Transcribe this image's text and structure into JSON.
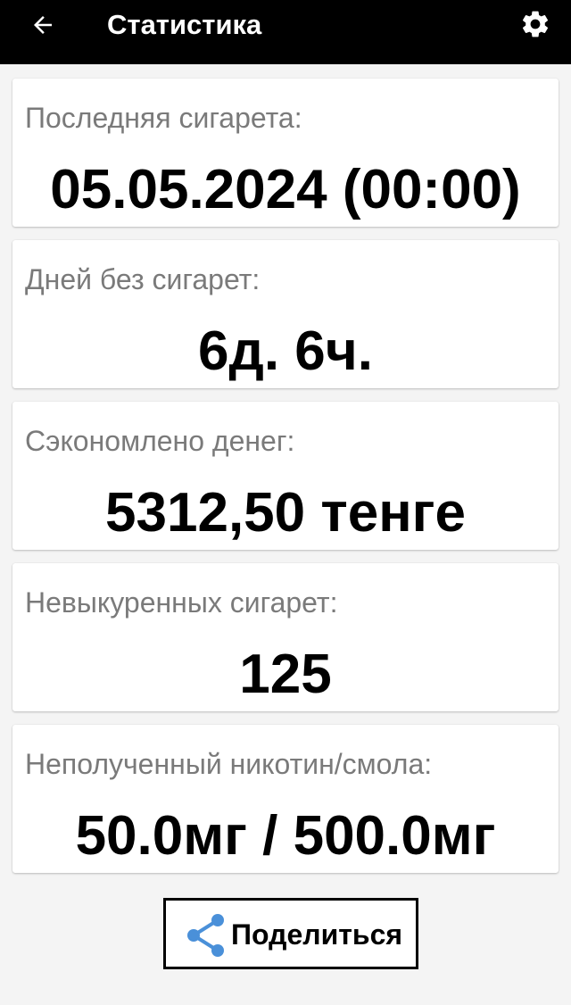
{
  "header": {
    "title": "Статистика",
    "back_icon": "arrow-left-icon",
    "settings_icon": "gear-icon",
    "background": "#000000"
  },
  "cards": [
    {
      "label": "Последняя сигарета:",
      "value": "05.05.2024 (00:00)"
    },
    {
      "label": "Дней без сигарет:",
      "value": "6д. 6ч."
    },
    {
      "label": "Сэкономлено денег:",
      "value": "5312,50 тенге"
    },
    {
      "label": "Невыкуренных сигарет:",
      "value": "125"
    },
    {
      "label": "Неполученный никотин/смола:",
      "value": "50.0мг / 500.0мг"
    }
  ],
  "share": {
    "label": "Поделиться",
    "icon": "share-icon",
    "icon_color": "#4a90d9"
  }
}
